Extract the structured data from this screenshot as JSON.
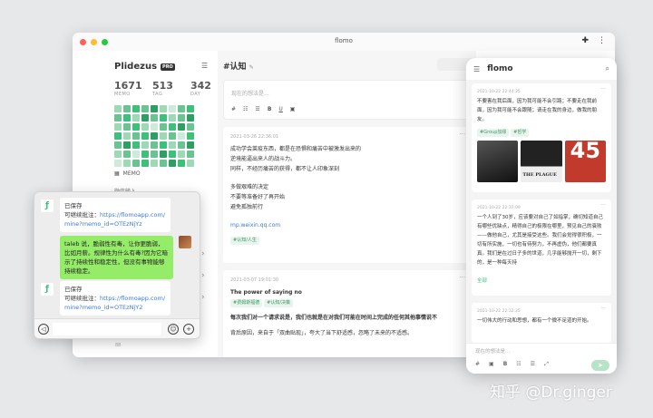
{
  "window": {
    "title": "flomo"
  },
  "sidebar": {
    "user": "Plidezus",
    "badge": "PRO",
    "stats": [
      {
        "value": "1671",
        "label": "MEMO"
      },
      {
        "value": "513",
        "label": "TAG"
      },
      {
        "value": "342",
        "label": "DAY"
      }
    ],
    "memo_label": "MEMO",
    "nav2": "微信输入"
  },
  "content": {
    "title": "#认知",
    "placeholder": "现在的想法是...",
    "memo1": {
      "time": "2021-03-26 22:36:01",
      "lines": [
        "成功学会莱疫东西，都是在恐惧和痛苦中被激发出来的",
        "逆境能逼出来人的战斗力。",
        "同样，不经历痛苦的获得，都不让人印象深刻",
        "多做艰难的决定",
        "不要等准备好了再开始",
        "避免孤独前行"
      ],
      "link": "mp.weixin.qq.com",
      "tag": "#认知/人生"
    },
    "memo2": {
      "time": "2021-03-07 19:01:30",
      "title": "The power of saying no",
      "tags": [
        "#费姆斯福德",
        "#认知/决策"
      ],
      "line1": "每次我们对一个请求说是，我们也就是在对我们可能在时间上完成的任何其他事情说不",
      "line2": "背后原因，来自于「双曲贴现」，夸大了当下舒适感，忽略了未来的不适感。"
    }
  },
  "phone": {
    "title": "flomo",
    "card1": {
      "time": "2021-10-22 22:44:25",
      "text": "不要害在我后面，因为我可能不会引路；不要走在我前面，因为我可能不会跟随；请走在我的身边，做我的朋友。",
      "tags": [
        "#Group加缪",
        "#哲学"
      ],
      "photo_text": "THE PLAGUE",
      "photo_num": "45"
    },
    "card2": {
      "time": "2021-10-22 22:37:09",
      "text": "一个人到了30岁，应该要对自己了如指掌，确切知道自己有哪些优缺点，精得自己的极限在哪里，预见自己的衰败——做他自己，尤其是接受这些。我们会觉得很积极，一切有所实施，一切也有待努力，不再虚伪，他们都要真真。我们是在过日子多的世道，几乎能够抛开一切，剩下的，是一种每天持",
      "more": "全部"
    },
    "card3": {
      "time": "2021-10-22 22:32:25",
      "text": "一切伟大的行动和思想，都有一个微不足道的开始。"
    },
    "placeholder": "现在的想法是..."
  },
  "chat": {
    "msg1": {
      "title": "已保存",
      "label": "可继续批注：",
      "link": "https://flomoapp.com/mine?memo_id=OTEzNjYz"
    },
    "msg2": "taleb 说，脆弱性有毒，让你更脆弱，比如月薪。规律性为什么有毒?因为它暗示了持续性和稳定性，但没有事物能够持续稳定。",
    "msg3": {
      "title": "已保存",
      "label": "可继续批注：",
      "link": "https://flomoapp.com/mine?memo_id=OTEzNjY2"
    }
  },
  "watermark": "知乎 @Dr.ginger",
  "colors": {
    "green": "#3ebf7a",
    "light_green": "#95ec69"
  }
}
